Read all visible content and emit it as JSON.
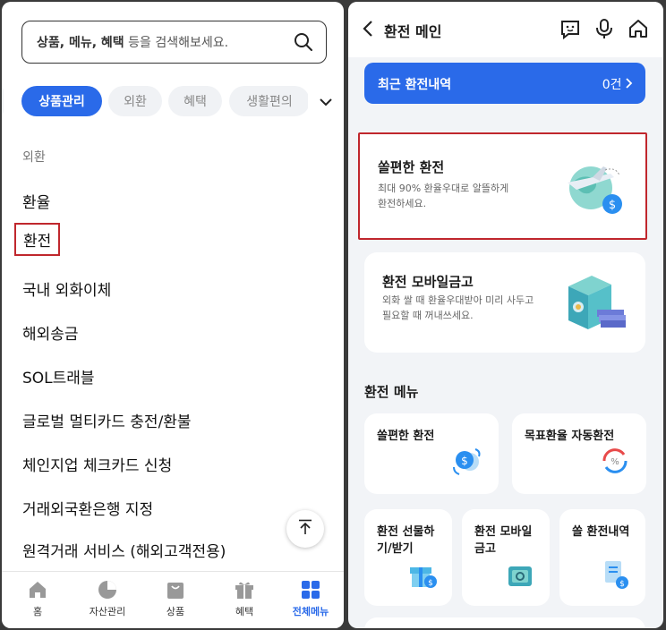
{
  "left": {
    "search": {
      "bold_part": "상품, 메뉴, 혜택",
      "rest": " 등을 검색해보세요."
    },
    "tabs": [
      "상품관리",
      "외환",
      "혜택",
      "생활편의"
    ],
    "section_label": "외환",
    "menu_items": [
      "환율",
      "환전",
      "국내 외화이체",
      "해외송금",
      "SOL트래블",
      "글로벌 멀티카드 충전/환불",
      "체인지업 체크카드 신청",
      "거래외국환은행 지정",
      "원격거래 서비스 (해외고객전용)"
    ],
    "bottom_nav": [
      "홈",
      "자산관리",
      "상품",
      "혜택",
      "전체메뉴"
    ]
  },
  "right": {
    "header_title": "환전 메인",
    "recent": {
      "label": "최근 환전내역",
      "count": "0건"
    },
    "card1": {
      "title": "쏠편한 환전",
      "desc1": "최대 90% 환율우대로 알뜰하게",
      "desc2": "환전하세요."
    },
    "card2": {
      "title": "환전 모바일금고",
      "desc1": "외화 쌀 때 환율우대받아 미리 사두고",
      "desc2": "필요할 때 꺼내쓰세요."
    },
    "section_title": "환전 메뉴",
    "tiles": [
      {
        "line1": "쏠편한 환전",
        "line2": ""
      },
      {
        "line1": "목표환율 자동환전",
        "line2": ""
      },
      {
        "line1": "환전 선물하",
        "line2": "기/받기"
      },
      {
        "line1": "환전 모바일",
        "line2": "금고"
      },
      {
        "line1": "쏠 환전내역",
        "line2": ""
      }
    ]
  },
  "colors": {
    "primary": "#2a6ae9",
    "highlight": "#c0272d"
  }
}
